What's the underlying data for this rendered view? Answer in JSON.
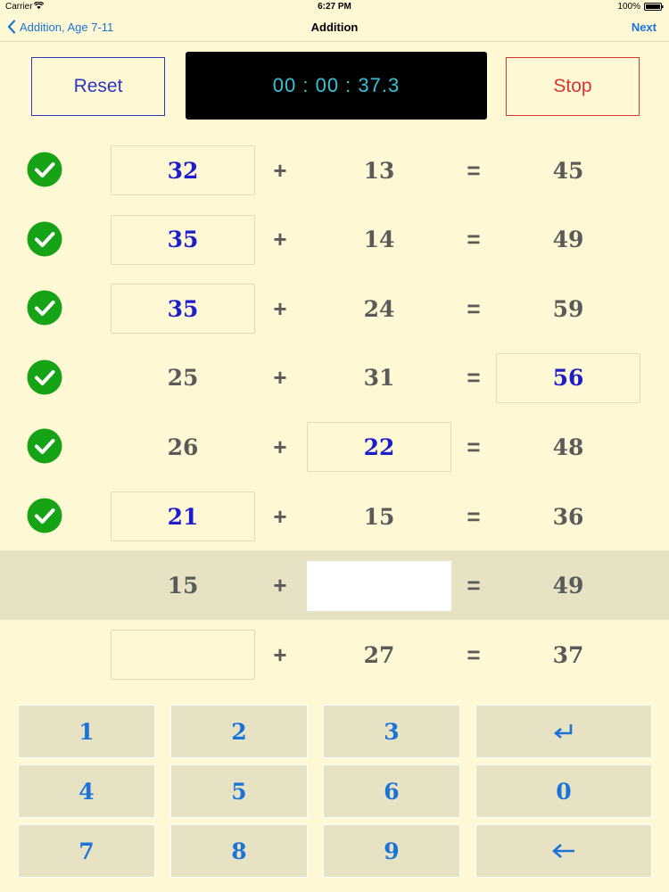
{
  "status_bar": {
    "carrier": "Carrier",
    "time": "6:27 PM",
    "battery": "100%"
  },
  "nav": {
    "back_label": "Addition, Age 7-11",
    "title": "Addition",
    "next_label": "Next"
  },
  "controls": {
    "reset_label": "Reset",
    "timer": "00 : 00 : 37.3",
    "stop_label": "Stop"
  },
  "equations": [
    {
      "a": "32",
      "b": "13",
      "sum": "45",
      "blank": "a",
      "correct": true
    },
    {
      "a": "35",
      "b": "14",
      "sum": "49",
      "blank": "a",
      "correct": true
    },
    {
      "a": "35",
      "b": "24",
      "sum": "59",
      "blank": "a",
      "correct": true
    },
    {
      "a": "25",
      "b": "31",
      "sum": "56",
      "blank": "sum",
      "correct": true
    },
    {
      "a": "26",
      "b": "22",
      "sum": "48",
      "blank": "b",
      "correct": true
    },
    {
      "a": "21",
      "b": "15",
      "sum": "36",
      "blank": "a",
      "correct": true
    },
    {
      "a": "15",
      "b": "",
      "sum": "49",
      "blank": "b",
      "correct": false,
      "active": true
    },
    {
      "a": "",
      "b": "27",
      "sum": "37",
      "blank": "a",
      "correct": false
    }
  ],
  "operators": {
    "plus": "+",
    "equals": "="
  },
  "keypad": {
    "k1": "1",
    "k2": "2",
    "k3": "3",
    "k4": "4",
    "k5": "5",
    "k6": "6",
    "k0": "0",
    "k7": "7",
    "k8": "8",
    "k9": "9",
    "enter_icon": "return-arrow-icon",
    "backspace_icon": "left-arrow-icon"
  },
  "colors": {
    "background": "#fff8d4",
    "accent": "#1a73d9",
    "entered_answer": "#1d1dcc",
    "check": "#16a316",
    "timer_text": "#35c3d8",
    "stop": "#d93434",
    "reset": "#2c36c2"
  }
}
